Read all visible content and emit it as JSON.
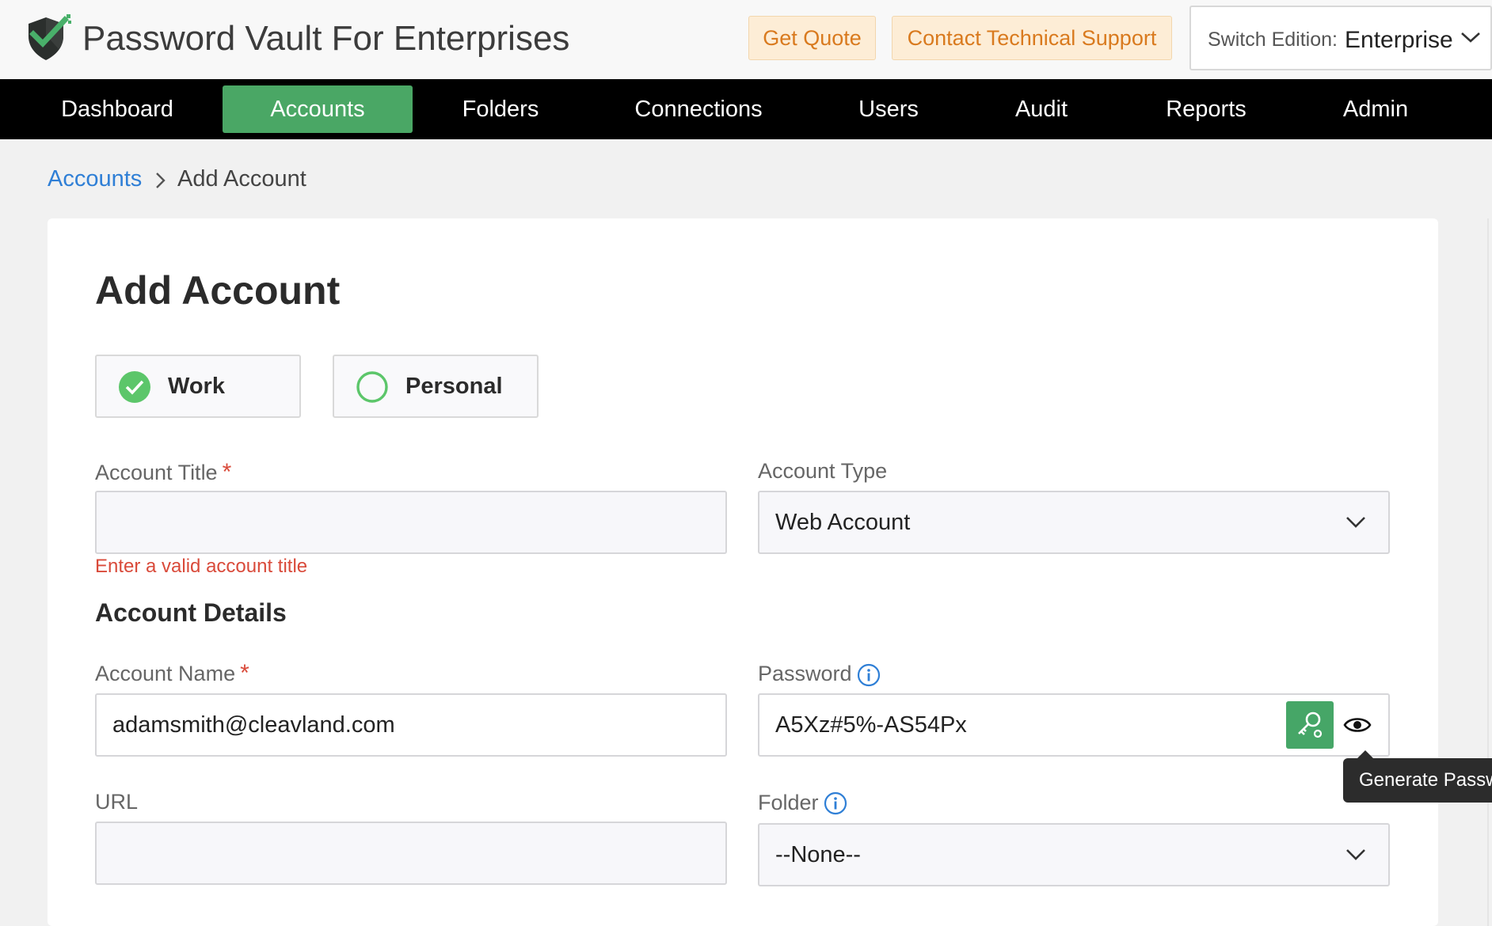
{
  "app": {
    "title": "Password Vault For Enterprises",
    "logo_icon": "shield-check-icon",
    "brand_color": "#4aa765"
  },
  "header": {
    "get_quote": "Get Quote",
    "contact_support": "Contact Technical Support",
    "edition_label": "Switch Edition:",
    "edition_value": "Enterprise"
  },
  "nav": {
    "items": [
      {
        "label": "Dashboard"
      },
      {
        "label": "Accounts",
        "active": true
      },
      {
        "label": "Folders"
      },
      {
        "label": "Connections"
      },
      {
        "label": "Users"
      },
      {
        "label": "Audit"
      },
      {
        "label": "Reports"
      },
      {
        "label": "Admin"
      }
    ]
  },
  "breadcrumb": {
    "parent": "Accounts",
    "current": "Add Account"
  },
  "form": {
    "title": "Add Account",
    "category_options": [
      {
        "label": "Work",
        "selected": true
      },
      {
        "label": "Personal",
        "selected": false
      }
    ],
    "account_title": {
      "label": "Account Title",
      "required_mark": "*",
      "value": "",
      "error": "Enter a valid account title"
    },
    "account_type": {
      "label": "Account Type",
      "value": "Web Account"
    },
    "details_heading": "Account Details",
    "account_name": {
      "label": "Account Name",
      "required_mark": "*",
      "value": "adamsmith@cleavland.com"
    },
    "password": {
      "label": "Password",
      "value": "A5Xz#5%-AS54Px",
      "tooltip": "Generate Password"
    },
    "url": {
      "label": "URL",
      "value": ""
    },
    "folder": {
      "label": "Folder",
      "value": "--None--"
    }
  }
}
